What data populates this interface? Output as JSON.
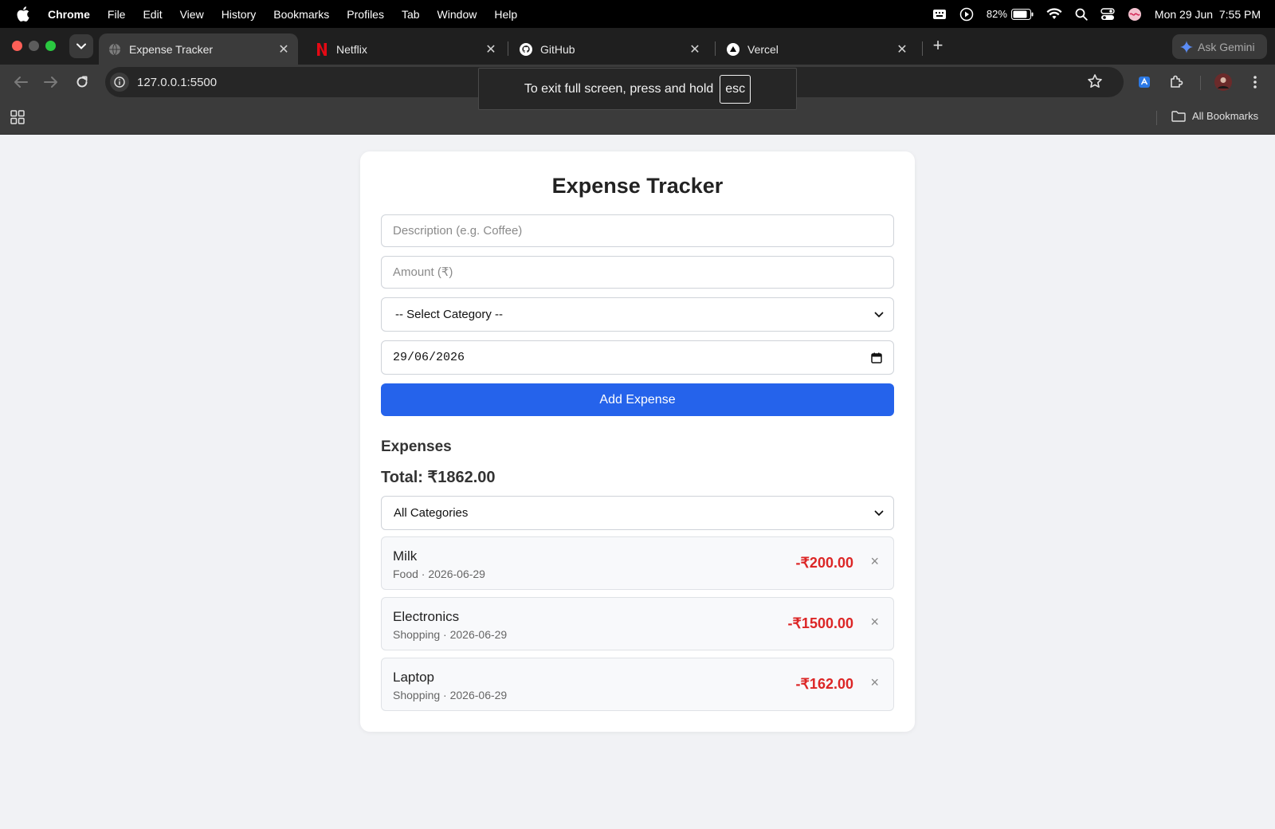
{
  "menubar": {
    "app": "Chrome",
    "items": [
      "File",
      "Edit",
      "View",
      "History",
      "Bookmarks",
      "Profiles",
      "Tab",
      "Window",
      "Help"
    ],
    "battery": "82%",
    "datetime": "Mon 29 Jun  7:55 PM"
  },
  "tabs": [
    {
      "title": "Expense Tracker",
      "active": true
    },
    {
      "title": "Netflix",
      "active": false
    },
    {
      "title": "GitHub",
      "active": false
    },
    {
      "title": "Vercel",
      "active": false
    }
  ],
  "gemini": {
    "label": "Ask Gemini"
  },
  "omnibox": {
    "url": "127.0.0.1:5500"
  },
  "bookmarks": {
    "all_label": "All Bookmarks"
  },
  "toast": {
    "text": "To exit full screen, press and hold",
    "key": "esc"
  },
  "app": {
    "title": "Expense Tracker",
    "form": {
      "description_placeholder": "Description (e.g. Coffee)",
      "amount_placeholder": "Amount (₹)",
      "category_selected": "-- Select Category --",
      "date_value": "29/06/2026",
      "add_label": "Add Expense"
    },
    "expenses_heading": "Expenses",
    "total_label": "Total: ₹1862.00",
    "filter_selected": "All Categories",
    "expenses": [
      {
        "name": "Milk",
        "meta": "Food · 2026-06-29",
        "amount": "-₹200.00"
      },
      {
        "name": "Electronics",
        "meta": "Shopping · 2026-06-29",
        "amount": "-₹1500.00"
      },
      {
        "name": "Laptop",
        "meta": "Shopping · 2026-06-29",
        "amount": "-₹162.00"
      }
    ],
    "delete_glyph": "×"
  },
  "colors": {
    "accent": "#2563eb",
    "negative": "#dc2626"
  }
}
